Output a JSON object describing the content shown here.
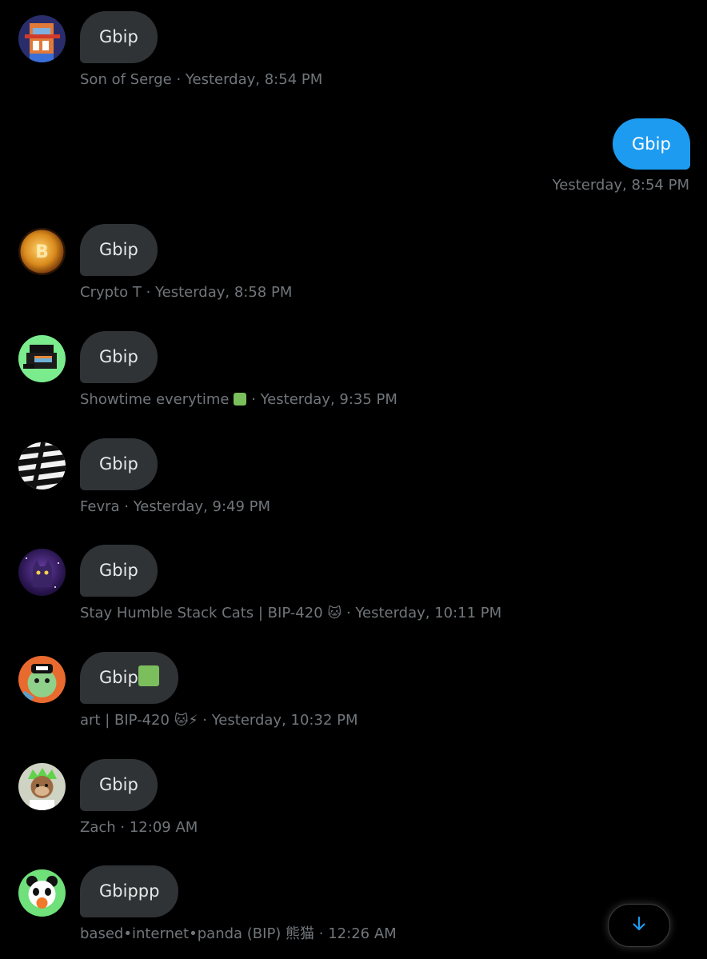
{
  "colors": {
    "background": "#000000",
    "bubble_in": "#2f3336",
    "bubble_out": "#1d9bf0",
    "meta_text": "#71767b",
    "accent": "#1d9bf0"
  },
  "messages": [
    {
      "sender": "Son of Serge",
      "text": "Gbip",
      "time": "Yesterday, 8:54 PM",
      "sep": " · ",
      "avatar_icon": "pixel-fox-avatar-icon"
    },
    {
      "sender": "Crypto T",
      "text": "Gbip",
      "time": "Yesterday, 8:58 PM",
      "sep": " · ",
      "avatar_icon": "gold-bitcoin-avatar-icon"
    },
    {
      "sender": "Showtime everytime",
      "sender_emoji": "green-square-emoji",
      "text": "Gbip",
      "time": "Yesterday, 9:35 PM",
      "sep": " · ",
      "avatar_icon": "pixel-character-avatar-icon"
    },
    {
      "sender": "Fevra",
      "text": "Gbip",
      "time": "Yesterday, 9:49 PM",
      "sep": " · ",
      "avatar_icon": "zebra-pattern-avatar-icon"
    },
    {
      "sender": "Stay Humble Stack Cats | BIP-420",
      "sender_emoji": "🐱",
      "text": "Gbip",
      "time": "Yesterday, 10:11 PM",
      "sep": " · ",
      "avatar_icon": "galaxy-cat-avatar-icon"
    },
    {
      "sender": "art | BIP-420",
      "sender_emoji": "🐱⚡",
      "text": "Gbip",
      "text_emoji": "green-square-emoji",
      "time": "Yesterday, 10:32 PM",
      "sep": " · ",
      "avatar_icon": "cartoon-character-avatar-icon"
    },
    {
      "sender": "Zach",
      "text": "Gbip",
      "time": "12:09 AM",
      "sep": " · ",
      "avatar_icon": "monkey-avatar-icon"
    },
    {
      "sender": "based•internet•panda (BIP) 熊猫",
      "text": "Gbippp",
      "time": "12:26 AM",
      "sep": " · ",
      "avatar_icon": "panda-avatar-icon"
    }
  ],
  "outgoing": {
    "text": "Gbip",
    "time": "Yesterday, 8:54 PM"
  },
  "scroll_button": {
    "icon": "arrow-down-icon"
  }
}
